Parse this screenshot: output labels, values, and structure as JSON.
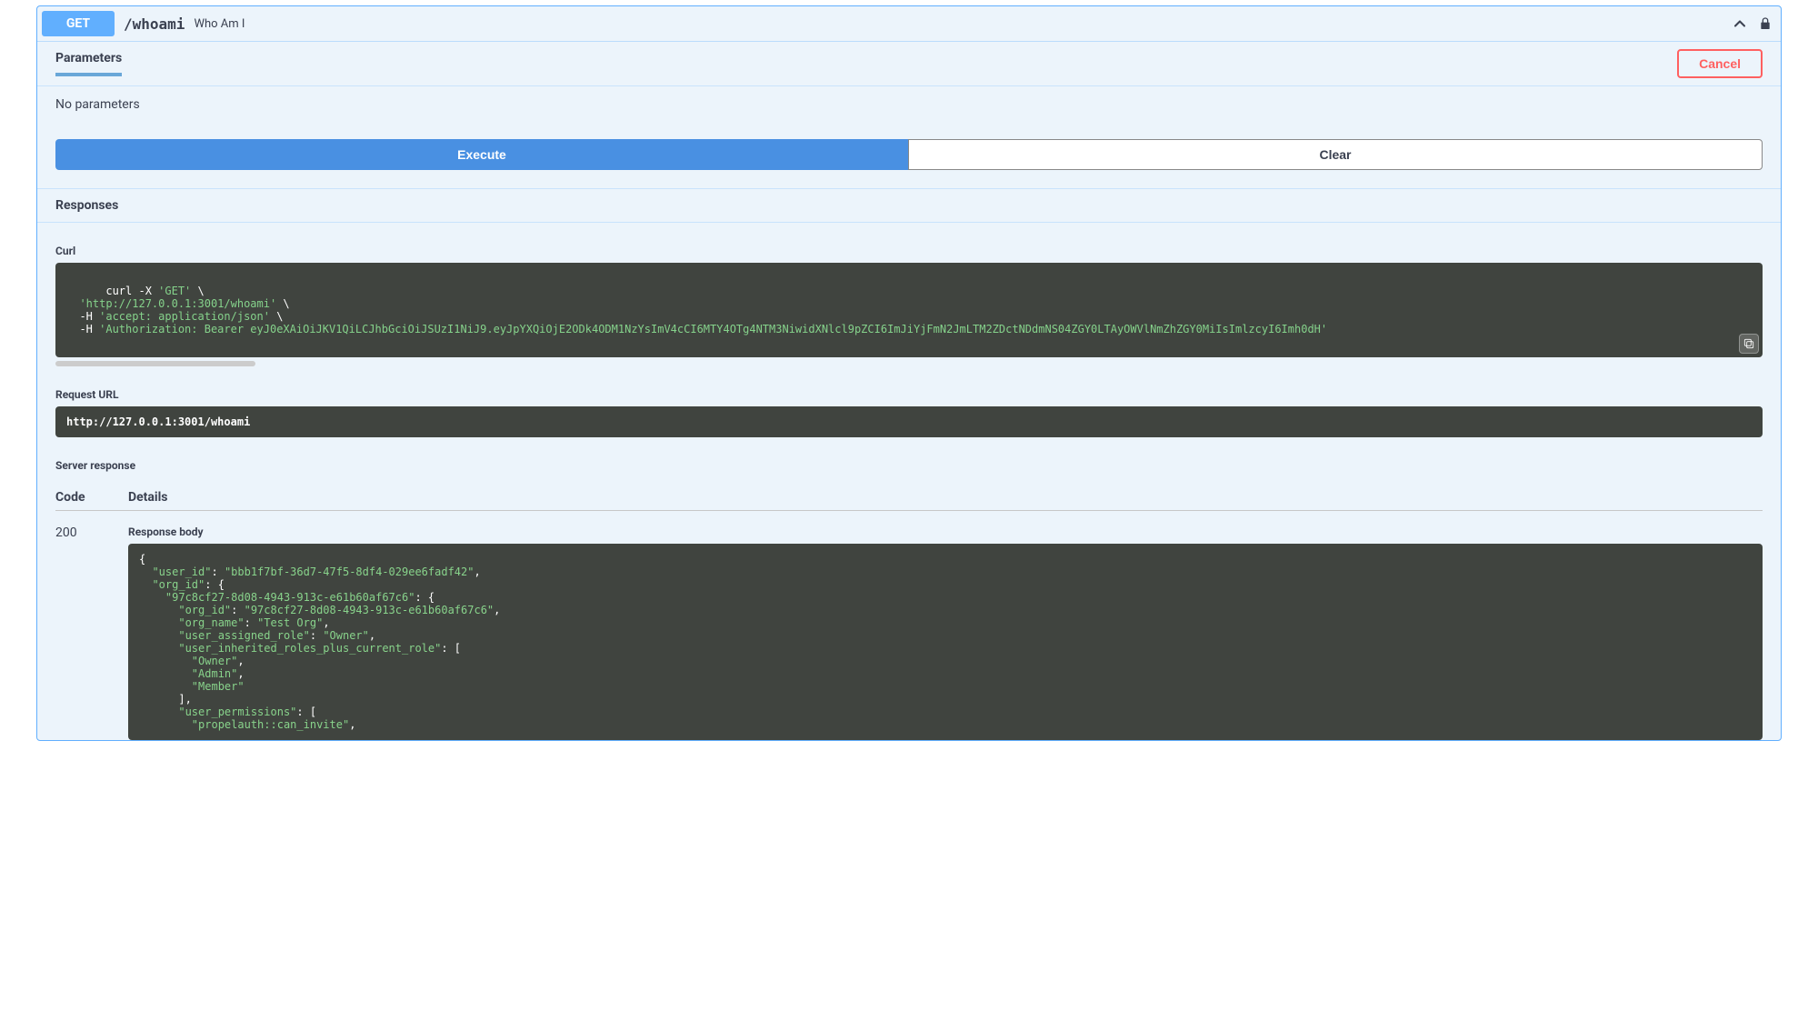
{
  "operation": {
    "method": "GET",
    "path": "/whoami",
    "summary": "Who Am I"
  },
  "parameters": {
    "tab_label": "Parameters",
    "cancel_label": "Cancel",
    "empty_text": "No parameters"
  },
  "actions": {
    "execute_label": "Execute",
    "clear_label": "Clear"
  },
  "responses": {
    "heading": "Responses",
    "curl_label": "Curl",
    "request_url_label": "Request URL",
    "server_response_label": "Server response",
    "code_header": "Code",
    "details_header": "Details",
    "response_body_label": "Response body"
  },
  "curl": {
    "line1_a": "curl -X ",
    "line1_b": "'GET'",
    "line1_c": " \\",
    "line2_a": "  ",
    "line2_b": "'http://127.0.0.1:3001/whoami'",
    "line2_c": " \\",
    "line3_a": "  -H ",
    "line3_b": "'accept: application/json'",
    "line3_c": " \\",
    "line4_a": "  -H ",
    "line4_b": "'Authorization: Bearer eyJ0eXAiOiJKV1QiLCJhbGciOiJSUzI1NiJ9.eyJpYXQiOjE2ODk4ODM1NzYsImV4cCI6MTY4OTg4NTM3NiwidXNlcl9pZCI6ImJiYjFmN2JmLTM2ZDctNDdmNS04ZGY0LTAyOWVlNmZhZGY0MiIsImlzcyI6Imh0dH'"
  },
  "request_url": "http://127.0.0.1:3001/whoami",
  "response": {
    "status_code": "200",
    "body_lines": [
      {
        "indent": 0,
        "type": "punc",
        "text": "{"
      },
      {
        "indent": 1,
        "type": "kv",
        "key": "\"user_id\"",
        "val": "\"bbb1f7bf-36d7-47f5-8df4-029ee6fadf42\"",
        "trail": ","
      },
      {
        "indent": 1,
        "type": "kopen",
        "key": "\"org_id\"",
        "open": "{"
      },
      {
        "indent": 2,
        "type": "kopen",
        "key": "\"97c8cf27-8d08-4943-913c-e61b60af67c6\"",
        "open": "{"
      },
      {
        "indent": 3,
        "type": "kv",
        "key": "\"org_id\"",
        "val": "\"97c8cf27-8d08-4943-913c-e61b60af67c6\"",
        "trail": ","
      },
      {
        "indent": 3,
        "type": "kv",
        "key": "\"org_name\"",
        "val": "\"Test Org\"",
        "trail": ","
      },
      {
        "indent": 3,
        "type": "kv",
        "key": "\"user_assigned_role\"",
        "val": "\"Owner\"",
        "trail": ","
      },
      {
        "indent": 3,
        "type": "kopen",
        "key": "\"user_inherited_roles_plus_current_role\"",
        "open": "["
      },
      {
        "indent": 4,
        "type": "val",
        "val": "\"Owner\"",
        "trail": ","
      },
      {
        "indent": 4,
        "type": "val",
        "val": "\"Admin\"",
        "trail": ","
      },
      {
        "indent": 4,
        "type": "val",
        "val": "\"Member\"",
        "trail": ""
      },
      {
        "indent": 3,
        "type": "punc",
        "text": "],"
      },
      {
        "indent": 3,
        "type": "kopen",
        "key": "\"user_permissions\"",
        "open": "["
      },
      {
        "indent": 4,
        "type": "val",
        "val": "\"propelauth::can_invite\"",
        "trail": ","
      }
    ]
  }
}
